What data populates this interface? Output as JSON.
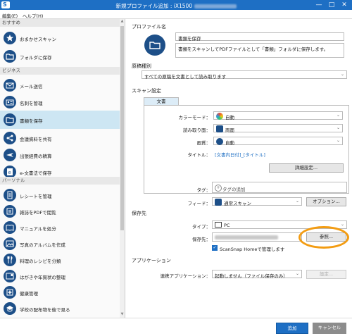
{
  "window": {
    "title": "新規プロファイル追加 : iX1500",
    "minimize": "—",
    "maximize": "□",
    "close": "✕"
  },
  "menu": {
    "edit": "編集(E)",
    "help": "ヘルプ(H)"
  },
  "sidebar": {
    "sections": [
      {
        "label": "おすすめ"
      },
      {
        "label": "ビジネス"
      },
      {
        "label": "パーソナル"
      }
    ],
    "items": [
      {
        "label": "おまかせスキャン",
        "icon": "star-icon"
      },
      {
        "label": "フォルダに保存",
        "icon": "folder-icon"
      },
      {
        "label": "メール送信",
        "icon": "mail-icon"
      },
      {
        "label": "名刺を管理",
        "icon": "business-card-icon"
      },
      {
        "label": "書類を保存",
        "icon": "folder-icon",
        "selected": true
      },
      {
        "label": "会議資料を共有",
        "icon": "share-icon"
      },
      {
        "label": "出張経費の精算",
        "icon": "airplane-icon"
      },
      {
        "label": "e-文書法で保存",
        "icon": "e-document-icon"
      },
      {
        "label": "レシートを管理",
        "icon": "receipt-icon"
      },
      {
        "label": "雑誌をPDFで閲覧",
        "icon": "magazine-icon"
      },
      {
        "label": "マニュアルを処分",
        "icon": "manual-icon"
      },
      {
        "label": "写真のアルバムを作成",
        "icon": "photo-album-icon"
      },
      {
        "label": "料理のレシピを分類",
        "icon": "recipe-icon"
      },
      {
        "label": "はがきや年賀状の整理",
        "icon": "postcard-icon"
      },
      {
        "label": "健康管理",
        "icon": "health-icon"
      },
      {
        "label": "学校の配布物を後で見る",
        "icon": "school-icon"
      }
    ]
  },
  "profile": {
    "section_label": "プロファイル名",
    "name_value": "書類を保存",
    "description": "書類をスキャンしてPDFファイルとして「書類」フォルダに保存します。"
  },
  "doc_type": {
    "section_label": "原稿種別",
    "value": "すべての原稿を文書として読み取ります"
  },
  "scan_settings": {
    "section_label": "スキャン設定",
    "tab_label": "文書",
    "color_mode_label": "カラーモード：",
    "color_mode_value": "自動",
    "scan_side_label": "読み取り面：",
    "scan_side_value": "両面",
    "quality_label": "画質：",
    "quality_value": "自動",
    "title_label": "タイトル：",
    "title_value": "[文書内日付]_[タイトル]",
    "detail_button": "詳細設定..."
  },
  "tag": {
    "label": "タグ：",
    "add_label": "タグの追加"
  },
  "feed": {
    "label": "フィード：",
    "value": "通常スキャン",
    "option_button": "オプション..."
  },
  "save": {
    "section_label": "保存先",
    "type_label": "タイプ：",
    "type_value": "PC",
    "dest_label": "保存先：",
    "browse_button": "参照...",
    "scansnap_home_label": "ScanSnap Homeで管理します"
  },
  "application": {
    "section_label": "アプリケーション",
    "linked_label": "連携アプリケーション：",
    "linked_value": "起動しません（ファイル保存のみ）",
    "settings_button": "設定..."
  },
  "footer": {
    "add_button": "追加",
    "cancel_button": "キャンセル"
  },
  "colors": {
    "accent": "#1e6fc4",
    "icon_bg": "#1d4f88",
    "highlight": "#f39c12",
    "selected_bg": "#cde6f3"
  }
}
